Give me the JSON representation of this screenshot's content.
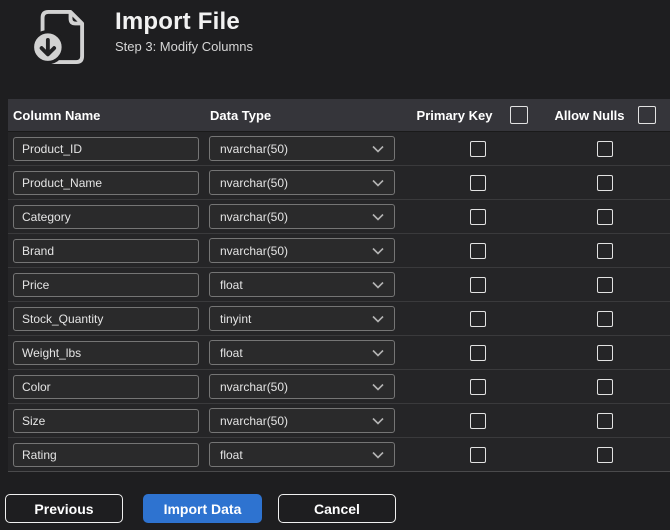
{
  "header": {
    "title": "Import File",
    "subtitle": "Step 3: Modify Columns"
  },
  "icons": {
    "header_icon": "file-import-icon",
    "dropdown_icon": "chevron-down-icon"
  },
  "table": {
    "columns": {
      "column_name": "Column Name",
      "data_type": "Data Type",
      "primary_key": "Primary Key",
      "allow_nulls": "Allow Nulls"
    },
    "header_checkboxes": {
      "primary_key_all_checked": false,
      "allow_nulls_all_checked": false
    },
    "rows": [
      {
        "name": "Product_ID",
        "type": "nvarchar(50)",
        "primary_key": false,
        "allow_nulls": false
      },
      {
        "name": "Product_Name",
        "type": "nvarchar(50)",
        "primary_key": false,
        "allow_nulls": false
      },
      {
        "name": "Category",
        "type": "nvarchar(50)",
        "primary_key": false,
        "allow_nulls": false
      },
      {
        "name": "Brand",
        "type": "nvarchar(50)",
        "primary_key": false,
        "allow_nulls": false
      },
      {
        "name": "Price",
        "type": "float",
        "primary_key": false,
        "allow_nulls": false
      },
      {
        "name": "Stock_Quantity",
        "type": "tinyint",
        "primary_key": false,
        "allow_nulls": false
      },
      {
        "name": "Weight_lbs",
        "type": "float",
        "primary_key": false,
        "allow_nulls": false
      },
      {
        "name": "Color",
        "type": "nvarchar(50)",
        "primary_key": false,
        "allow_nulls": false
      },
      {
        "name": "Size",
        "type": "nvarchar(50)",
        "primary_key": false,
        "allow_nulls": false
      },
      {
        "name": "Rating",
        "type": "float",
        "primary_key": false,
        "allow_nulls": false
      }
    ]
  },
  "footer": {
    "previous_label": "Previous",
    "import_label": "Import Data",
    "cancel_label": "Cancel"
  },
  "colors": {
    "accent_blue": "#2e73d0",
    "page_background": "#1e1e20",
    "table_header_background": "#35353a",
    "row_background": "#252527",
    "icon_gray": "#d2d2d2"
  }
}
